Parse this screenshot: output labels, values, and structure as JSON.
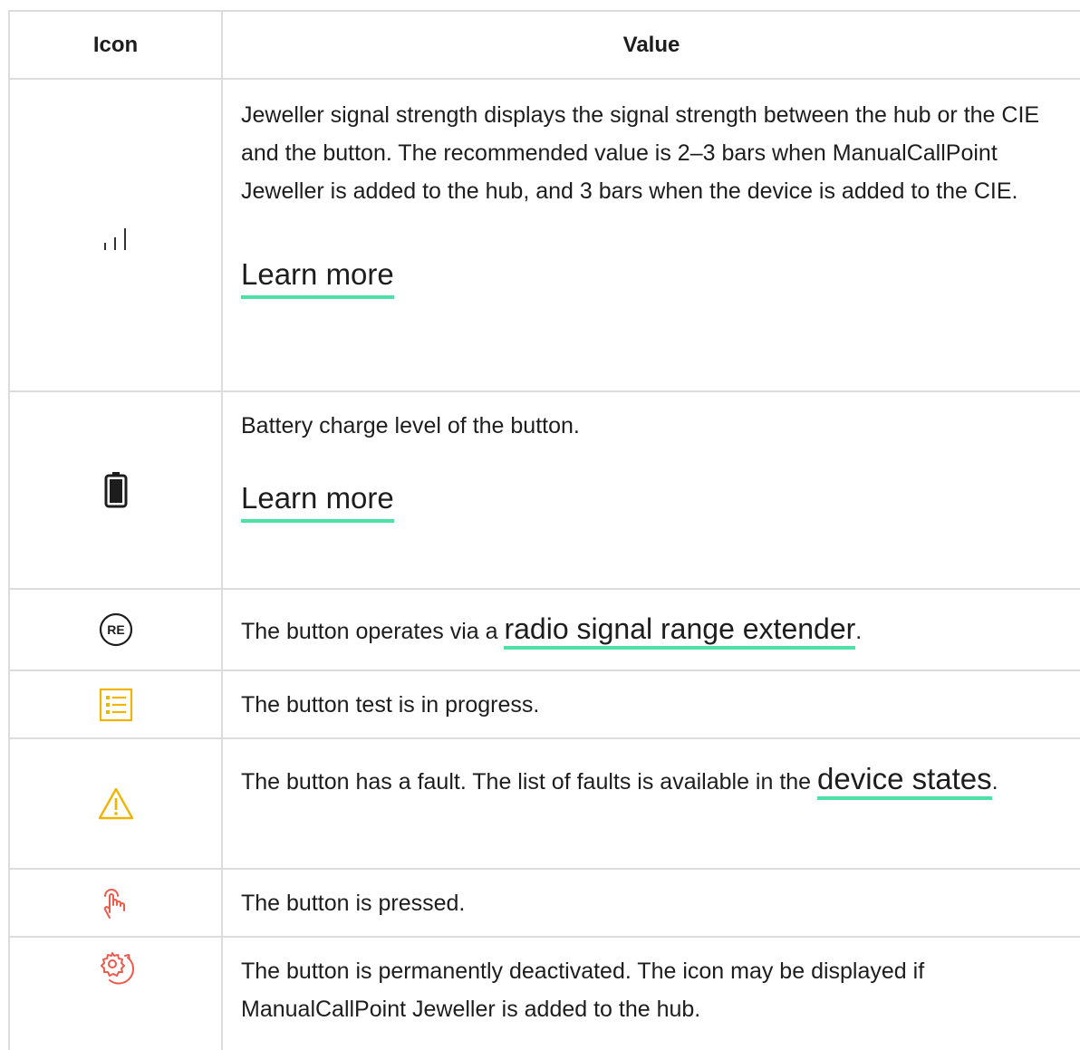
{
  "table": {
    "headers": {
      "icon": "Icon",
      "value": "Value"
    },
    "rows": [
      {
        "icon": "signal-strength-icon",
        "text": "Jeweller signal strength displays the signal strength between the hub or the CIE and the button. The recommended value is 2–3 bars when ManualCallPoint Jeweller is added to the hub, and 3 bars when the device is added to the CIE.",
        "link": "Learn more"
      },
      {
        "icon": "battery-icon",
        "text": "Battery charge level of the button.",
        "link": "Learn more"
      },
      {
        "icon": "range-extender-icon",
        "icon_label": "RE",
        "text_before": "The button operates via a ",
        "link": "radio signal range extender",
        "text_after": "."
      },
      {
        "icon": "test-checklist-icon",
        "icon_color": "#f0b400",
        "text": "The button test is in progress."
      },
      {
        "icon": "warning-triangle-icon",
        "icon_color": "#f0b400",
        "text_before": "The button has a fault. The list of faults is available in the ",
        "link": "device states",
        "text_after": "."
      },
      {
        "icon": "hand-press-icon",
        "icon_color": "#ee5a4b",
        "text": "The button is pressed."
      },
      {
        "icon": "gear-deactivated-icon",
        "icon_color": "#ee5a4b",
        "text": "The button is permanently deactivated. The icon may be displayed if ManualCallPoint Jeweller is added to the hub."
      }
    ]
  },
  "colors": {
    "link_underline": "#4fe0a8",
    "border": "#dcdcdc",
    "warning": "#f0b400",
    "alert": "#ee5a4b"
  }
}
